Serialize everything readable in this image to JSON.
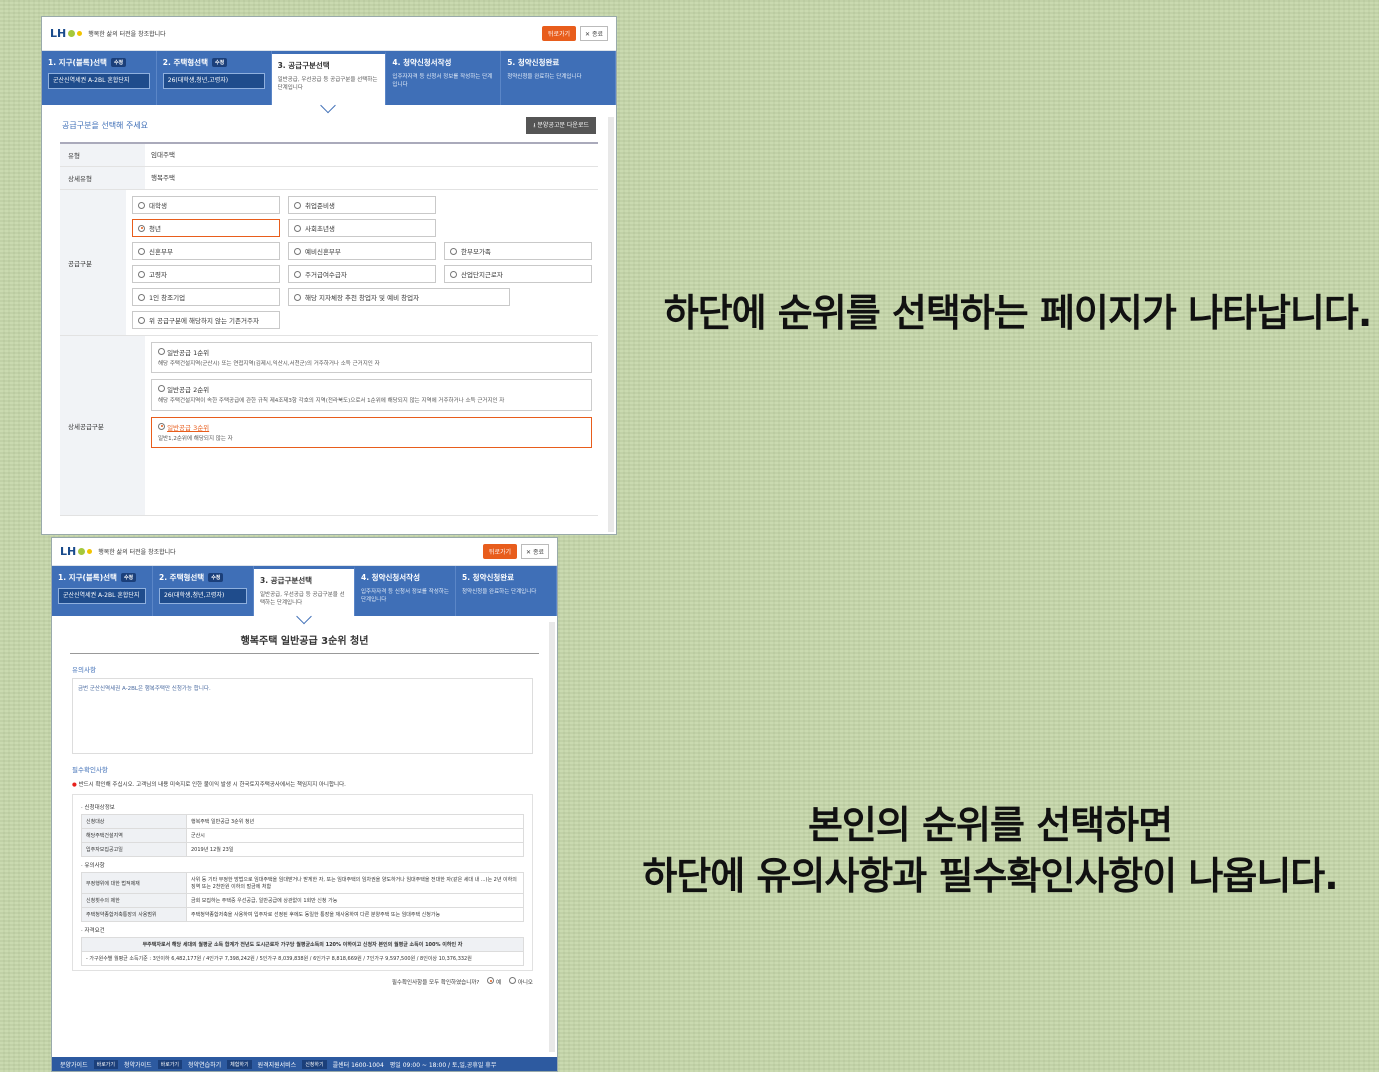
{
  "header": {
    "logo": "LH",
    "tagline": "행복한 삶의 터전을 창조합니다",
    "print_label": "뒤로가기",
    "close_label": "✕ 종료"
  },
  "steps": [
    {
      "title": "1. 지구(블록)선택",
      "chip": "수정",
      "value": "군산신역세권 A-2BL 혼합단지"
    },
    {
      "title": "2. 주택형선택",
      "chip": "수정",
      "value": "26(대학생,청년,고령자)"
    },
    {
      "title": "3. 공급구분선택",
      "desc": "일반공급, 우선공급 등 공급구분을 선택하는 단계입니다"
    },
    {
      "title": "4. 청약신청서작성",
      "desc": "입주자자격 등 신청서 정보를 작성하는 단계입니다"
    },
    {
      "title": "5. 청약신청완료",
      "desc": "청약신청을 완료하는 단계입니다"
    }
  ],
  "screen1": {
    "section_title": "공급구분을 선택해 주세요",
    "download_label": "분양공고문 다운로드",
    "type_label": "유형",
    "type_value": "임대주택",
    "subtype_label": "상세유형",
    "subtype_value": "행복주택",
    "supply_label": "공급구분",
    "supply_options": [
      "대학생",
      "취업준비생",
      "",
      "청년",
      "사회초년생",
      "",
      "신혼부부",
      "예비신혼부부",
      "한부모가족",
      "고령자",
      "주거급여수급자",
      "산업단지근로자",
      "1인 창조기업",
      "해당 지자체장 추천 창업자 및 예비 창업자",
      "",
      "위 공급구분에 해당하지 않는 기존거주자",
      "",
      ""
    ],
    "rank_label": "상세공급구분",
    "ranks": [
      {
        "title": "일반공급 1순위",
        "desc": "해당 주택건설지역(군산시) 또는 연접지역(김제시,익산시,서천군)의 거주하거나 소득 근거지인 자"
      },
      {
        "title": "일반공급 2순위",
        "desc": "해당 주택건설지역이 속한 주택공급에 관한 규칙 제4조제3항 각호의 지역(전라북도)으로서 1순위에 해당되지 않는 지역에 거주하거나 소득 근거지인 자"
      },
      {
        "title": "일반공급 3순위",
        "desc": "일반1,2순위에 해당되지 않는 자"
      }
    ]
  },
  "screen2": {
    "heading": "행복주택 일반공급 3순위 청년",
    "notice_label": "유의사항",
    "notice_text": "금번 군산신역세권 A-2BL은 행복주택만 신청가능 합니다.",
    "check_label": "필수확인사항",
    "warning": "반드시 확인해 주십시오. 고객님의 내용 미숙지로 인한 불이익 발생 시 한국토지주택공사에서는 책임지지 아니합니다.",
    "info_heading": "신청대상정보",
    "info_rows": [
      [
        "신청대상",
        "행복주택 일반공급 3순위 청년"
      ],
      [
        "해당주택건설지역",
        "군산시"
      ],
      [
        "입주자모집공고일",
        "2019년 12월 23일"
      ]
    ],
    "caution_heading": "유의사항",
    "caution_rows": [
      [
        "부정행위에 대한 법적제재",
        "사위 등 기타 부정한 방법으로 임대주택을 임대받거나 받게한 자, 또는 임대주택의 임차권을 양도하거나 임대주택을 전대한 자(같은 세대 내 ...)는 2년 이하의 징역 또는 2천만원 이하의 벌금에 처함"
      ],
      [
        "신청횟수의 제한",
        "금회 모집하는 주택중 우선공급, 일반공급에 상관없이 1회만 신청 가능"
      ],
      [
        "주택청약종합저축통장의 사용범위",
        "주택청약종합저축을 사용하여 입주자로 선정된 후에도 동일한 통장을 재사용하여 다른 분양주택 또는 임대주택 신청가능"
      ]
    ],
    "qual_heading": "자격요건",
    "qual_head": "무주택자로서 해당 세대의 월평균 소득 합계가 전년도 도시근로자 가구당 월평균소득의 120% 이하이고 신청자 본인의 월평균 소득이 100% 이하인 자",
    "qual_text": "- 가구원수별 월평균 소득기준 : 3인이하 6,482,177원 / 4인가구 7,398,242원 / 5인가구 8,039,838원 / 6인가구 8,818,669원 / 7인가구 9,597,500원 / 8인이상 10,376,332원",
    "agree_q": "필수확인사항을 모두 확인하였습니까?",
    "yes": "예",
    "no": "아니오",
    "footer": [
      "분양가이드",
      "바로가기",
      "청약가이드",
      "바로가기",
      "청약연습하기",
      "체험하기",
      "원격지원서비스",
      "신청하기",
      "콜센터 1600-1004",
      "평일 09:00 ~ 18:00 / 토,일,공휴일 휴무"
    ]
  },
  "captions": {
    "c1": "하단에 순위를 선택하는 페이지가 나타납니다.",
    "c2_line1": "본인의 순위를 선택하면",
    "c2_line2": "하단에 유의사항과 필수확인사항이 나옵니다."
  }
}
